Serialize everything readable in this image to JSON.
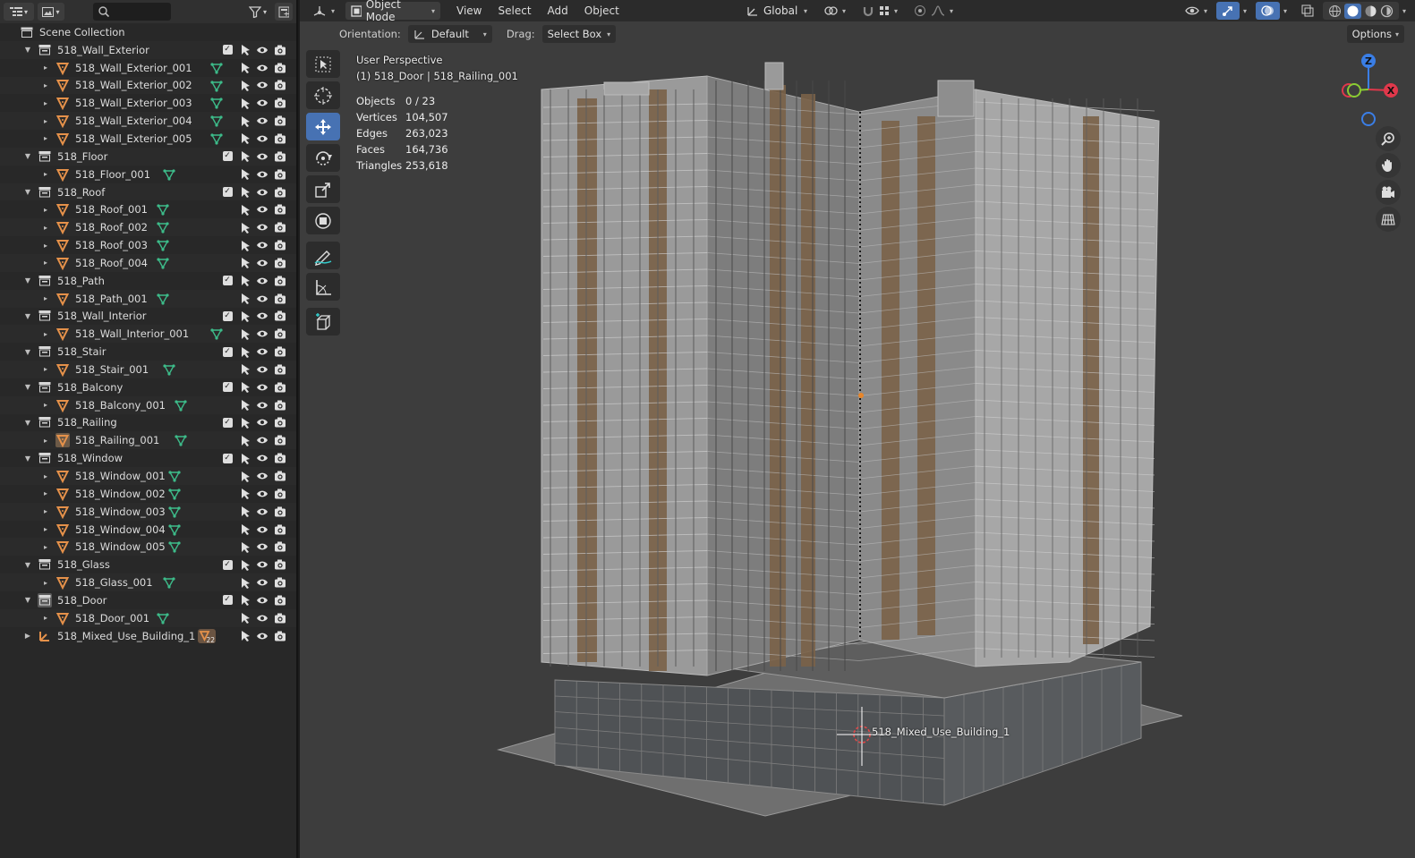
{
  "outliner": {
    "search_placeholder": "",
    "collection_root": "Scene Collection",
    "rows": [
      {
        "depth": 1,
        "type": "collection",
        "label": "518_Wall_Exterior",
        "open": true,
        "checked": true
      },
      {
        "depth": 2,
        "type": "mesh",
        "label": "518_Wall_Exterior_001"
      },
      {
        "depth": 2,
        "type": "mesh",
        "label": "518_Wall_Exterior_002"
      },
      {
        "depth": 2,
        "type": "mesh",
        "label": "518_Wall_Exterior_003"
      },
      {
        "depth": 2,
        "type": "mesh",
        "label": "518_Wall_Exterior_004"
      },
      {
        "depth": 2,
        "type": "mesh",
        "label": "518_Wall_Exterior_005"
      },
      {
        "depth": 1,
        "type": "collection",
        "label": "518_Floor",
        "open": true,
        "checked": true
      },
      {
        "depth": 2,
        "type": "mesh",
        "label": "518_Floor_001"
      },
      {
        "depth": 1,
        "type": "collection",
        "label": "518_Roof",
        "open": true,
        "checked": true
      },
      {
        "depth": 2,
        "type": "mesh",
        "label": "518_Roof_001"
      },
      {
        "depth": 2,
        "type": "mesh",
        "label": "518_Roof_002"
      },
      {
        "depth": 2,
        "type": "mesh",
        "label": "518_Roof_003"
      },
      {
        "depth": 2,
        "type": "mesh",
        "label": "518_Roof_004"
      },
      {
        "depth": 1,
        "type": "collection",
        "label": "518_Path",
        "open": true,
        "checked": true
      },
      {
        "depth": 2,
        "type": "mesh",
        "label": "518_Path_001"
      },
      {
        "depth": 1,
        "type": "collection",
        "label": "518_Wall_Interior",
        "open": true,
        "checked": true
      },
      {
        "depth": 2,
        "type": "mesh",
        "label": "518_Wall_Interior_001"
      },
      {
        "depth": 1,
        "type": "collection",
        "label": "518_Stair",
        "open": true,
        "checked": true
      },
      {
        "depth": 2,
        "type": "mesh",
        "label": "518_Stair_001"
      },
      {
        "depth": 1,
        "type": "collection",
        "label": "518_Balcony",
        "open": true,
        "checked": true
      },
      {
        "depth": 2,
        "type": "mesh",
        "label": "518_Balcony_001"
      },
      {
        "depth": 1,
        "type": "collection",
        "label": "518_Railing",
        "open": true,
        "checked": true
      },
      {
        "depth": 2,
        "type": "mesh",
        "label": "518_Railing_001",
        "active": true
      },
      {
        "depth": 1,
        "type": "collection",
        "label": "518_Window",
        "open": true,
        "checked": true
      },
      {
        "depth": 2,
        "type": "mesh",
        "label": "518_Window_001"
      },
      {
        "depth": 2,
        "type": "mesh",
        "label": "518_Window_002"
      },
      {
        "depth": 2,
        "type": "mesh",
        "label": "518_Window_003"
      },
      {
        "depth": 2,
        "type": "mesh",
        "label": "518_Window_004"
      },
      {
        "depth": 2,
        "type": "mesh",
        "label": "518_Window_005"
      },
      {
        "depth": 1,
        "type": "collection",
        "label": "518_Glass",
        "open": true,
        "checked": true
      },
      {
        "depth": 2,
        "type": "mesh",
        "label": "518_Glass_001"
      },
      {
        "depth": 1,
        "type": "collection",
        "label": "518_Door",
        "open": true,
        "checked": true,
        "active": true
      },
      {
        "depth": 2,
        "type": "mesh",
        "label": "518_Door_001"
      },
      {
        "depth": 1,
        "type": "empty",
        "label": "518_Mixed_Use_Building_1",
        "open": false,
        "badge": "22"
      }
    ]
  },
  "viewport": {
    "mode": "Object Mode",
    "menus": [
      "View",
      "Select",
      "Add",
      "Object"
    ],
    "transform_orientation": "Global",
    "tool_settings": {
      "orientation_label": "Orientation:",
      "orientation_value": "Default",
      "drag_label": "Drag:",
      "drag_value": "Select Box"
    },
    "options_label": "Options",
    "view_name": "User Perspective",
    "active_info": "(1) 518_Door | 518_Railing_001",
    "stats": [
      {
        "key": "Objects",
        "value": "0 / 23"
      },
      {
        "key": "Vertices",
        "value": "104,507"
      },
      {
        "key": "Edges",
        "value": "263,023"
      },
      {
        "key": "Faces",
        "value": "164,736"
      },
      {
        "key": "Triangles",
        "value": "253,618"
      }
    ],
    "object_label": "518_Mixed_Use_Building_1",
    "gizmo_axes": [
      "Z",
      "X"
    ]
  },
  "colors": {
    "accent": "#4772b3",
    "mesh_icon": "#e5914a",
    "vertex_green": "#3dbc8a",
    "axis_x": "#e0384b",
    "axis_y": "#8bcb33",
    "axis_z": "#3a7ee6"
  }
}
